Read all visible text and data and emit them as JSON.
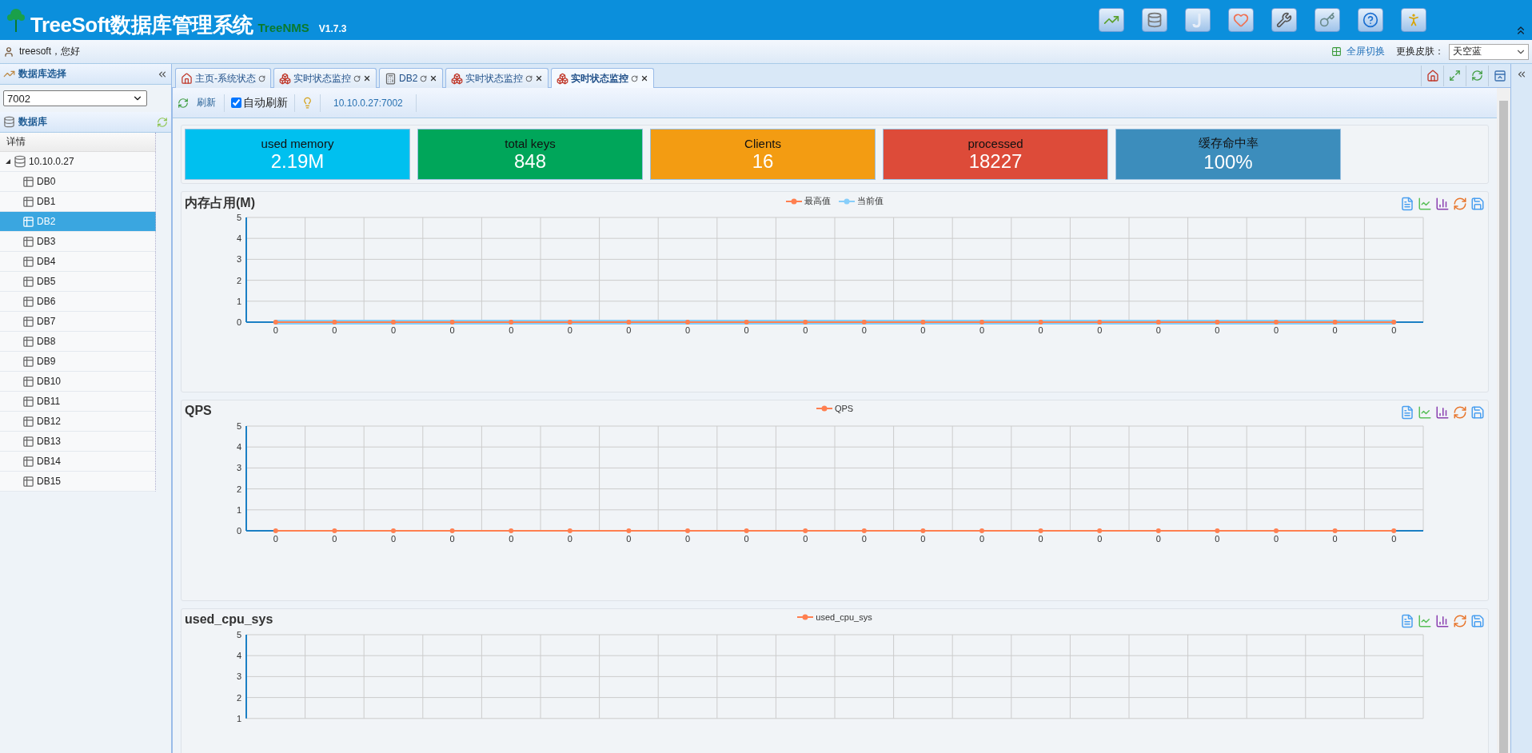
{
  "header": {
    "title": "TreeSoft数据库管理系统",
    "subtitle": "TreeNMS",
    "version": "V1.7.3"
  },
  "user_bar": {
    "greeting": "treesoft，您好",
    "fullscreen": "全屏切换",
    "skin_label": "更换皮肤：",
    "skin_value": "天空蓝"
  },
  "sidebar": {
    "title": "数据库选择",
    "db_select": "7002",
    "tree_title": "数据库",
    "column": "详情",
    "tree": [
      {
        "label": "10.10.0.27",
        "expanded": true,
        "selected": false,
        "children": [
          {
            "label": "DB0",
            "selected": false
          },
          {
            "label": "DB1",
            "selected": false
          },
          {
            "label": "DB2",
            "selected": true
          },
          {
            "label": "DB3",
            "selected": false
          },
          {
            "label": "DB4",
            "selected": false
          },
          {
            "label": "DB5",
            "selected": false
          },
          {
            "label": "DB6",
            "selected": false
          },
          {
            "label": "DB7",
            "selected": false
          },
          {
            "label": "DB8",
            "selected": false
          },
          {
            "label": "DB9",
            "selected": false
          },
          {
            "label": "DB10",
            "selected": false
          },
          {
            "label": "DB11",
            "selected": false
          },
          {
            "label": "DB12",
            "selected": false
          },
          {
            "label": "DB13",
            "selected": false
          },
          {
            "label": "DB14",
            "selected": false
          },
          {
            "label": "DB15",
            "selected": false
          }
        ]
      }
    ]
  },
  "tabs": [
    {
      "label": "主页-系统状态",
      "kind": "home",
      "closable": false,
      "selected": false
    },
    {
      "label": "实时状态监控",
      "kind": "cubes",
      "closable": true,
      "selected": false
    },
    {
      "label": "DB2",
      "kind": "grid",
      "closable": true,
      "selected": false
    },
    {
      "label": "实时状态监控",
      "kind": "cubes",
      "closable": true,
      "selected": false
    },
    {
      "label": "实时状态监控",
      "kind": "cubes",
      "closable": true,
      "selected": true
    }
  ],
  "toolbar": {
    "refresh": "刷新",
    "auto_refresh": {
      "label": "自动刷新",
      "checked": true
    },
    "address": "10.10.0.27:7002"
  },
  "stats": [
    {
      "label": "used memory",
      "value": "2.19M",
      "color": "#00c0ef"
    },
    {
      "label": "total keys",
      "value": "848",
      "color": "#00a65a"
    },
    {
      "label": "Clients",
      "value": "16",
      "color": "#f39c12"
    },
    {
      "label": "processed",
      "value": "18227",
      "color": "#dd4b39"
    },
    {
      "label": "缓存命中率",
      "value": "100%",
      "color": "#3c8dbc"
    }
  ],
  "charts": [
    {
      "title": "内存占用(M)",
      "chart_data": {
        "type": "line",
        "categories": [
          "0",
          "0",
          "0",
          "0",
          "0",
          "0",
          "0",
          "0",
          "0",
          "0",
          "0",
          "0",
          "0",
          "0",
          "0",
          "0",
          "0",
          "0",
          "0",
          "0"
        ],
        "ylim": [
          0,
          5
        ],
        "yticks": [
          0,
          1,
          2,
          3,
          4,
          5
        ],
        "grid": true,
        "series": [
          {
            "name": "最高值",
            "color": "#ff7f50",
            "marker": "circle",
            "values": [
              0,
              0,
              0,
              0,
              0,
              0,
              0,
              0,
              0,
              0,
              0,
              0,
              0,
              0,
              0,
              0,
              0,
              0,
              0,
              0
            ]
          },
          {
            "name": "当前值",
            "color": "#87cefa",
            "marker": "circle",
            "values": [
              0,
              0,
              0,
              0,
              0,
              0,
              0,
              0,
              0,
              0,
              0,
              0,
              0,
              0,
              0,
              0,
              0,
              0,
              0,
              0
            ]
          }
        ]
      }
    },
    {
      "title": "QPS",
      "chart_data": {
        "type": "line",
        "categories": [
          "0",
          "0",
          "0",
          "0",
          "0",
          "0",
          "0",
          "0",
          "0",
          "0",
          "0",
          "0",
          "0",
          "0",
          "0",
          "0",
          "0",
          "0",
          "0",
          "0"
        ],
        "ylim": [
          0,
          5
        ],
        "yticks": [
          0,
          1,
          2,
          3,
          4,
          5
        ],
        "grid": true,
        "series": [
          {
            "name": "QPS",
            "color": "#ff7f50",
            "marker": "circle",
            "values": [
              0,
              0,
              0,
              0,
              0,
              0,
              0,
              0,
              0,
              0,
              0,
              0,
              0,
              0,
              0,
              0,
              0,
              0,
              0,
              0
            ]
          }
        ]
      }
    },
    {
      "title": "used_cpu_sys",
      "chart_data": {
        "type": "line",
        "ylim": [
          1,
          5
        ],
        "yticks": [
          1,
          2,
          3,
          4,
          5
        ],
        "grid": true,
        "series": [
          {
            "name": "used_cpu_sys",
            "color": "#ff7f50"
          }
        ]
      }
    }
  ]
}
